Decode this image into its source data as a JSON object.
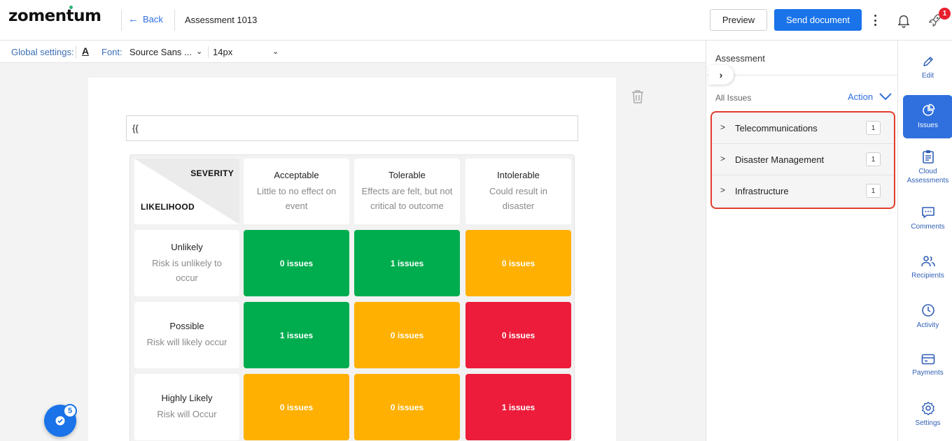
{
  "header": {
    "logo": "zomentum",
    "back_label": "Back",
    "doc_title": "Assessment 1013",
    "preview_label": "Preview",
    "send_label": "Send document",
    "notification_count": "1"
  },
  "settings": {
    "global_label": "Global settings:",
    "font_style_glyph": "A",
    "font_label": "Font:",
    "font_value": "Source Sans ...",
    "size_value": "14px"
  },
  "document": {
    "input_value": "{{"
  },
  "matrix": {
    "severity_label": "SEVERITY",
    "likelihood_label": "LIKELIHOOD",
    "severity_cols": [
      {
        "title": "Acceptable",
        "desc": "Little to no effect on event"
      },
      {
        "title": "Tolerable",
        "desc": "Effects are felt, but not critical to outcome"
      },
      {
        "title": "Intolerable",
        "desc": "Could result in disaster"
      }
    ],
    "likelihood_rows": [
      {
        "title": "Unlikely",
        "desc": "Risk is unlikely to occur"
      },
      {
        "title": "Possible",
        "desc": "Risk will likely occur"
      },
      {
        "title": "Highly Likely",
        "desc": "Risk will Occur"
      }
    ],
    "cells": [
      [
        {
          "label": "0 issues",
          "color": "#00ad4e"
        },
        {
          "label": "1 issues",
          "color": "#00ad4e"
        },
        {
          "label": "0 issues",
          "color": "#ffb000"
        }
      ],
      [
        {
          "label": "1 issues",
          "color": "#00ad4e"
        },
        {
          "label": "0 issues",
          "color": "#ffb000"
        },
        {
          "label": "0 issues",
          "color": "#ec1c3a"
        }
      ],
      [
        {
          "label": "0 issues",
          "color": "#ffb000"
        },
        {
          "label": "0 issues",
          "color": "#ffb000"
        },
        {
          "label": "1 issues",
          "color": "#ec1c3a"
        }
      ]
    ]
  },
  "fab": {
    "badge": "5"
  },
  "panel": {
    "title": "Assessment",
    "all_issues_label": "All Issues",
    "action_label": "Action",
    "issues": [
      {
        "name": "Telecommunications",
        "count": "1"
      },
      {
        "name": "Disaster Management",
        "count": "1"
      },
      {
        "name": "Infrastructure",
        "count": "1"
      }
    ]
  },
  "rail": {
    "items": [
      {
        "label": "Edit",
        "icon": "pencil-icon"
      },
      {
        "label": "Issues",
        "icon": "pie-chart-icon"
      },
      {
        "label": "Cloud Assessments",
        "icon": "clipboard-icon"
      },
      {
        "label": "Comments",
        "icon": "comment-icon"
      },
      {
        "label": "Recipients",
        "icon": "users-icon"
      },
      {
        "label": "Activity",
        "icon": "clock-icon"
      },
      {
        "label": "Payments",
        "icon": "card-icon"
      },
      {
        "label": "Settings",
        "icon": "gear-icon"
      }
    ],
    "accent": "#2f6fde"
  }
}
